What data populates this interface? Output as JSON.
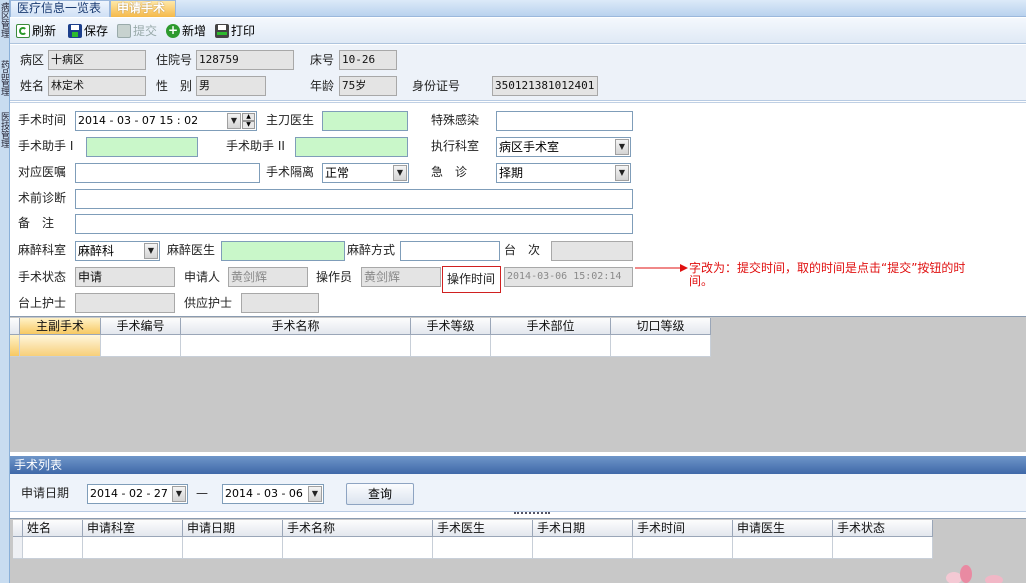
{
  "side_tabs": [
    "病区管理",
    "药品管理",
    "医技管理"
  ],
  "tabs": [
    {
      "label": "医疗信息一览表",
      "active": false
    },
    {
      "label": "申请手术",
      "active": true
    }
  ],
  "toolbar": {
    "refresh": "刷新",
    "save": "保存",
    "submit": "提交",
    "add": "新增",
    "print": "打印"
  },
  "patient": {
    "ward_label": "病区",
    "ward": "十病区",
    "admission_label": "住院号",
    "admission": "128759",
    "bed_label": "床号",
    "bed": "10-26",
    "name_label": "姓名",
    "name": "林定术",
    "sex_label": "性　别",
    "sex": "男",
    "age_label": "年龄",
    "age": "75岁",
    "id_label": "身份证号",
    "id": "350121381012401"
  },
  "form": {
    "surgery_time_label": "手术时间",
    "surgery_time": "2014 - 03 - 07   15 : 02",
    "chief_doctor_label": "主刀医生",
    "chief_doctor": "",
    "special_infection_label": "特殊感染",
    "special_infection": "",
    "assistant1_label": "手术助手 I",
    "assistant1": "",
    "assistant2_label": "手术助手 II",
    "assistant2": "",
    "exec_dept_label": "执行科室",
    "exec_dept": "病区手术室",
    "order_label": "对应医嘱",
    "order": "",
    "isolation_label": "手术隔离",
    "isolation": "正常",
    "emergency_label": "急　诊",
    "emergency": "择期",
    "diagnosis_label": "术前诊断",
    "diagnosis": "",
    "remark_label": "备　注",
    "remark": "",
    "anes_dept_label": "麻醉科室",
    "anes_dept": "麻醉科",
    "anes_doctor_label": "麻醉医生",
    "anes_doctor": "",
    "anes_method_label": "麻醉方式",
    "anes_method": "",
    "table_no_label": "台　次",
    "table_no": "",
    "status_label": "手术状态",
    "status": "申请",
    "applicant_label": "申请人",
    "applicant": "黄剑辉",
    "operator_label": "操作员",
    "operator": "黄剑辉",
    "op_time_label": "操作时间",
    "op_time": "2014-03-06 15:02:14",
    "table_nurse_label": "台上护士",
    "table_nurse": "",
    "supply_nurse_label": "供应护士",
    "supply_nurse": ""
  },
  "annotation": {
    "line1": "字改为：提交时间，取的时间是点击“提交”按钮的时",
    "line2": "间。",
    "color": "#e01010"
  },
  "surgery_grid": {
    "columns": [
      "主副手术",
      "手术编号",
      "手术名称",
      "手术等级",
      "手术部位",
      "切口等级"
    ]
  },
  "list_section": {
    "title": "手术列表",
    "apply_date_label": "申请日期",
    "date_from": "2014 - 02 - 27",
    "sep": "—",
    "date_to": "2014 - 03 - 06",
    "query": "查询",
    "columns": [
      "姓名",
      "申请科室",
      "申请日期",
      "手术名称",
      "手术医生",
      "手术日期",
      "手术时间",
      "申请医生",
      "手术状态"
    ]
  }
}
